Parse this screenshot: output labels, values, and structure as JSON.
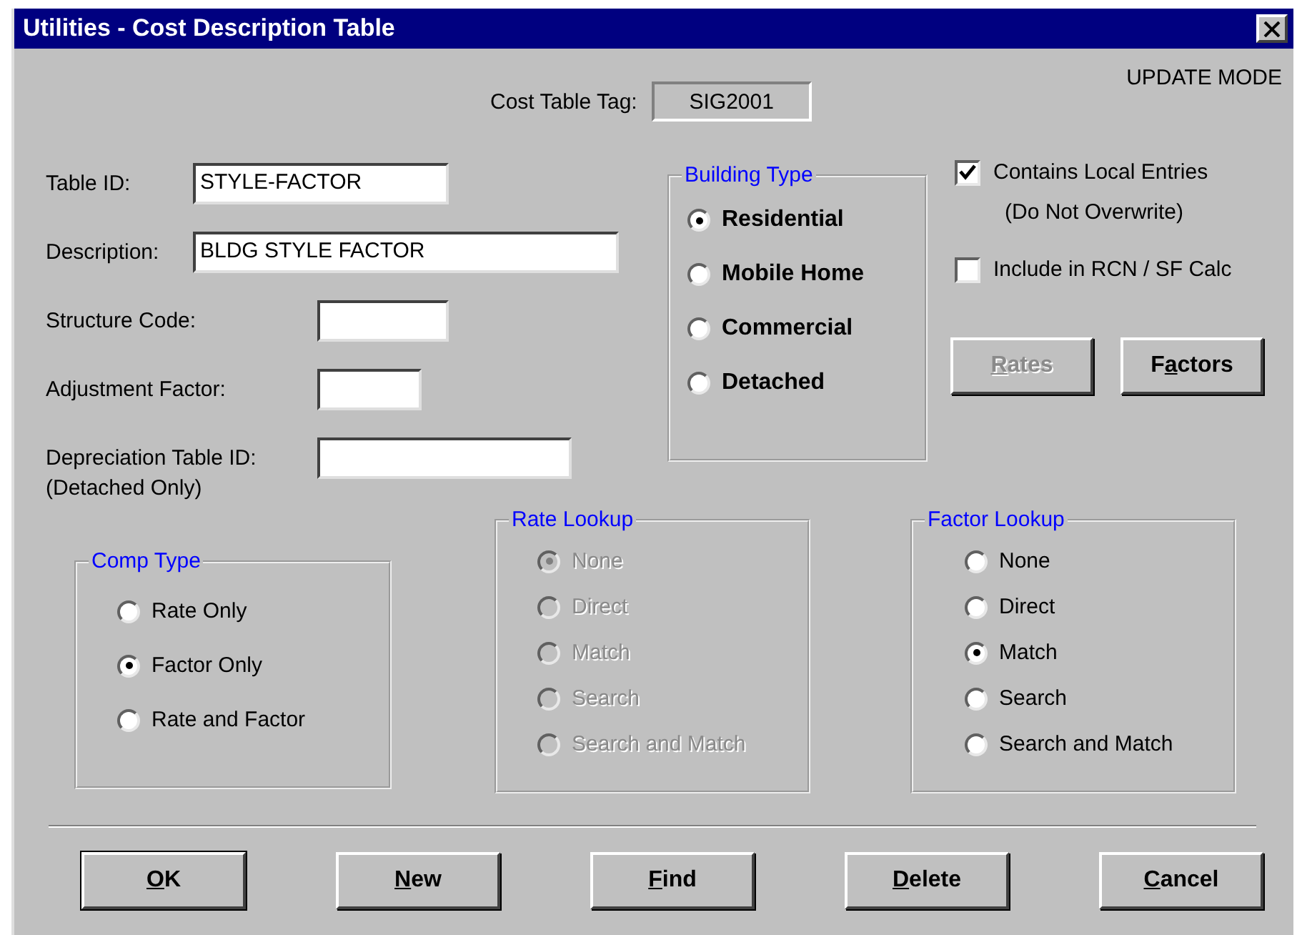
{
  "window": {
    "title": "Utilities - Cost Description Table"
  },
  "mode": "UPDATE MODE",
  "cost_table_tag": {
    "label": "Cost Table Tag:",
    "value": "SIG2001"
  },
  "fields": [
    {
      "label": "Table ID:",
      "value": "STYLE-FACTOR"
    },
    {
      "label": "Description:",
      "value": "BLDG STYLE FACTOR"
    },
    {
      "label": "Structure Code:"
    },
    {
      "label": "Adjustment Factor:"
    },
    {
      "label": "Depreciation Table ID:",
      "note": "(Detached Only)"
    }
  ],
  "building_type": {
    "title": "Building Type",
    "options": [
      {
        "label": "Residential",
        "selected": true
      },
      {
        "label": "Mobile Home",
        "selected": false
      },
      {
        "label": "Commercial",
        "selected": false
      },
      {
        "label": "Detached",
        "selected": false
      }
    ]
  },
  "checkboxes": [
    {
      "label": "Contains Local Entries",
      "note": "(Do Not Overwrite)",
      "checked": true
    },
    {
      "label": "Include in RCN / SF Calc",
      "checked": false
    }
  ],
  "side_buttons": [
    {
      "key": "R",
      "post": "ates",
      "disabled": true
    },
    {
      "pre": "F",
      "key": "a",
      "post": "ctors",
      "disabled": false
    }
  ],
  "comp_type": {
    "title": "Comp Type",
    "disabled": false,
    "options": [
      {
        "label": "Rate Only",
        "selected": false
      },
      {
        "label": "Factor Only",
        "selected": true
      },
      {
        "label": "Rate and Factor",
        "selected": false
      }
    ]
  },
  "rate_lookup": {
    "title": "Rate Lookup",
    "disabled": true,
    "options": [
      {
        "label": "None",
        "selected": true
      },
      {
        "label": "Direct",
        "selected": false
      },
      {
        "label": "Match",
        "selected": false
      },
      {
        "label": "Search",
        "selected": false
      },
      {
        "label": "Search and Match",
        "selected": false
      }
    ]
  },
  "factor_lookup": {
    "title": "Factor Lookup",
    "disabled": false,
    "options": [
      {
        "label": "None",
        "selected": false
      },
      {
        "label": "Direct",
        "selected": false
      },
      {
        "label": "Match",
        "selected": true
      },
      {
        "label": "Search",
        "selected": false
      },
      {
        "label": "Search and Match",
        "selected": false
      }
    ]
  },
  "buttons": [
    {
      "key": "O",
      "post": "K",
      "default": true
    },
    {
      "key": "N",
      "post": "ew",
      "default": false
    },
    {
      "key": "F",
      "post": "ind",
      "default": false
    },
    {
      "key": "D",
      "post": "elete",
      "default": false
    },
    {
      "key": "C",
      "post": "ancel",
      "default": false
    }
  ]
}
